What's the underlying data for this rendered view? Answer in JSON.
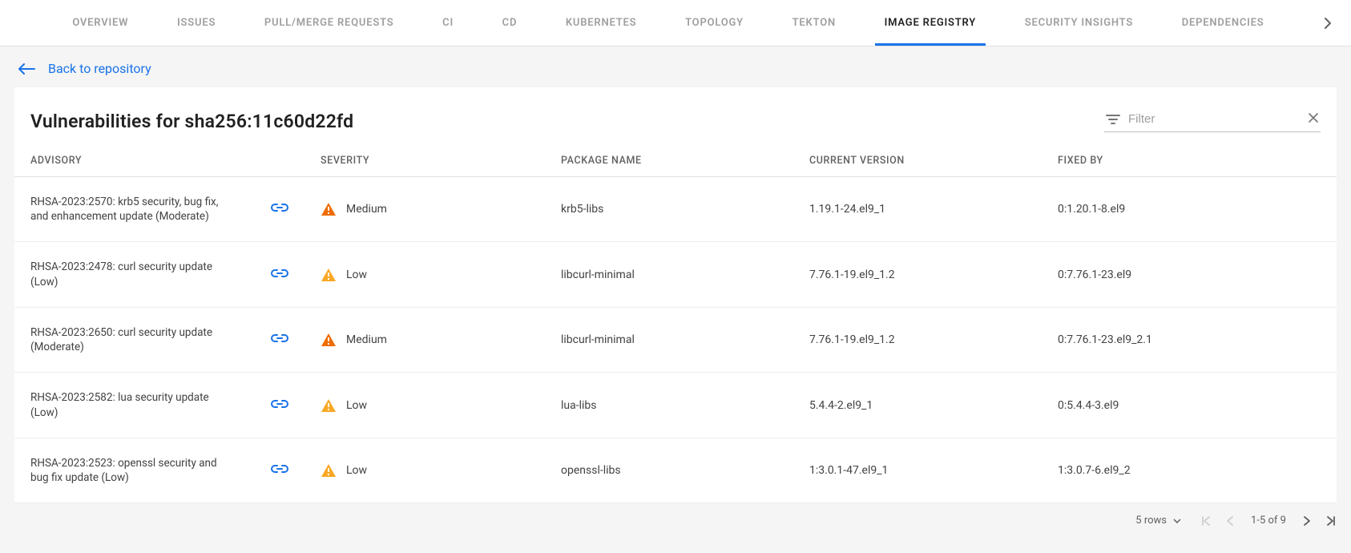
{
  "tabs": [
    {
      "label": "OVERVIEW"
    },
    {
      "label": "ISSUES"
    },
    {
      "label": "PULL/MERGE REQUESTS"
    },
    {
      "label": "CI"
    },
    {
      "label": "CD"
    },
    {
      "label": "KUBERNETES"
    },
    {
      "label": "TOPOLOGY"
    },
    {
      "label": "TEKTON"
    },
    {
      "label": "IMAGE REGISTRY",
      "active": true
    },
    {
      "label": "SECURITY INSIGHTS"
    },
    {
      "label": "DEPENDENCIES"
    }
  ],
  "back_link": "Back to repository",
  "title": "Vulnerabilities for sha256:11c60d22fd",
  "filter": {
    "placeholder": "Filter"
  },
  "columns": {
    "advisory": "ADVISORY",
    "severity": "SEVERITY",
    "package": "PACKAGE NAME",
    "current": "CURRENT VERSION",
    "fixed": "FIXED BY"
  },
  "rows": [
    {
      "advisory": "RHSA-2023:2570: krb5 security, bug fix, and enhancement update (Moderate)",
      "severity": "Medium",
      "package": "krb5-libs",
      "current": "1.19.1-24.el9_1",
      "fixed": "0:1.20.1-8.el9"
    },
    {
      "advisory": "RHSA-2023:2478: curl security update (Low)",
      "severity": "Low",
      "package": "libcurl-minimal",
      "current": "7.76.1-19.el9_1.2",
      "fixed": "0:7.76.1-23.el9"
    },
    {
      "advisory": "RHSA-2023:2650: curl security update (Moderate)",
      "severity": "Medium",
      "package": "libcurl-minimal",
      "current": "7.76.1-19.el9_1.2",
      "fixed": "0:7.76.1-23.el9_2.1"
    },
    {
      "advisory": "RHSA-2023:2582: lua security update (Low)",
      "severity": "Low",
      "package": "lua-libs",
      "current": "5.4.4-2.el9_1",
      "fixed": "0:5.4.4-3.el9"
    },
    {
      "advisory": "RHSA-2023:2523: openssl security and bug fix update (Low)",
      "severity": "Low",
      "package": "openssl-libs",
      "current": "1:3.0.1-47.el9_1",
      "fixed": "1:3.0.7-6.el9_2"
    }
  ],
  "pagination": {
    "rows_label": "5 rows",
    "range": "1-5 of 9"
  }
}
